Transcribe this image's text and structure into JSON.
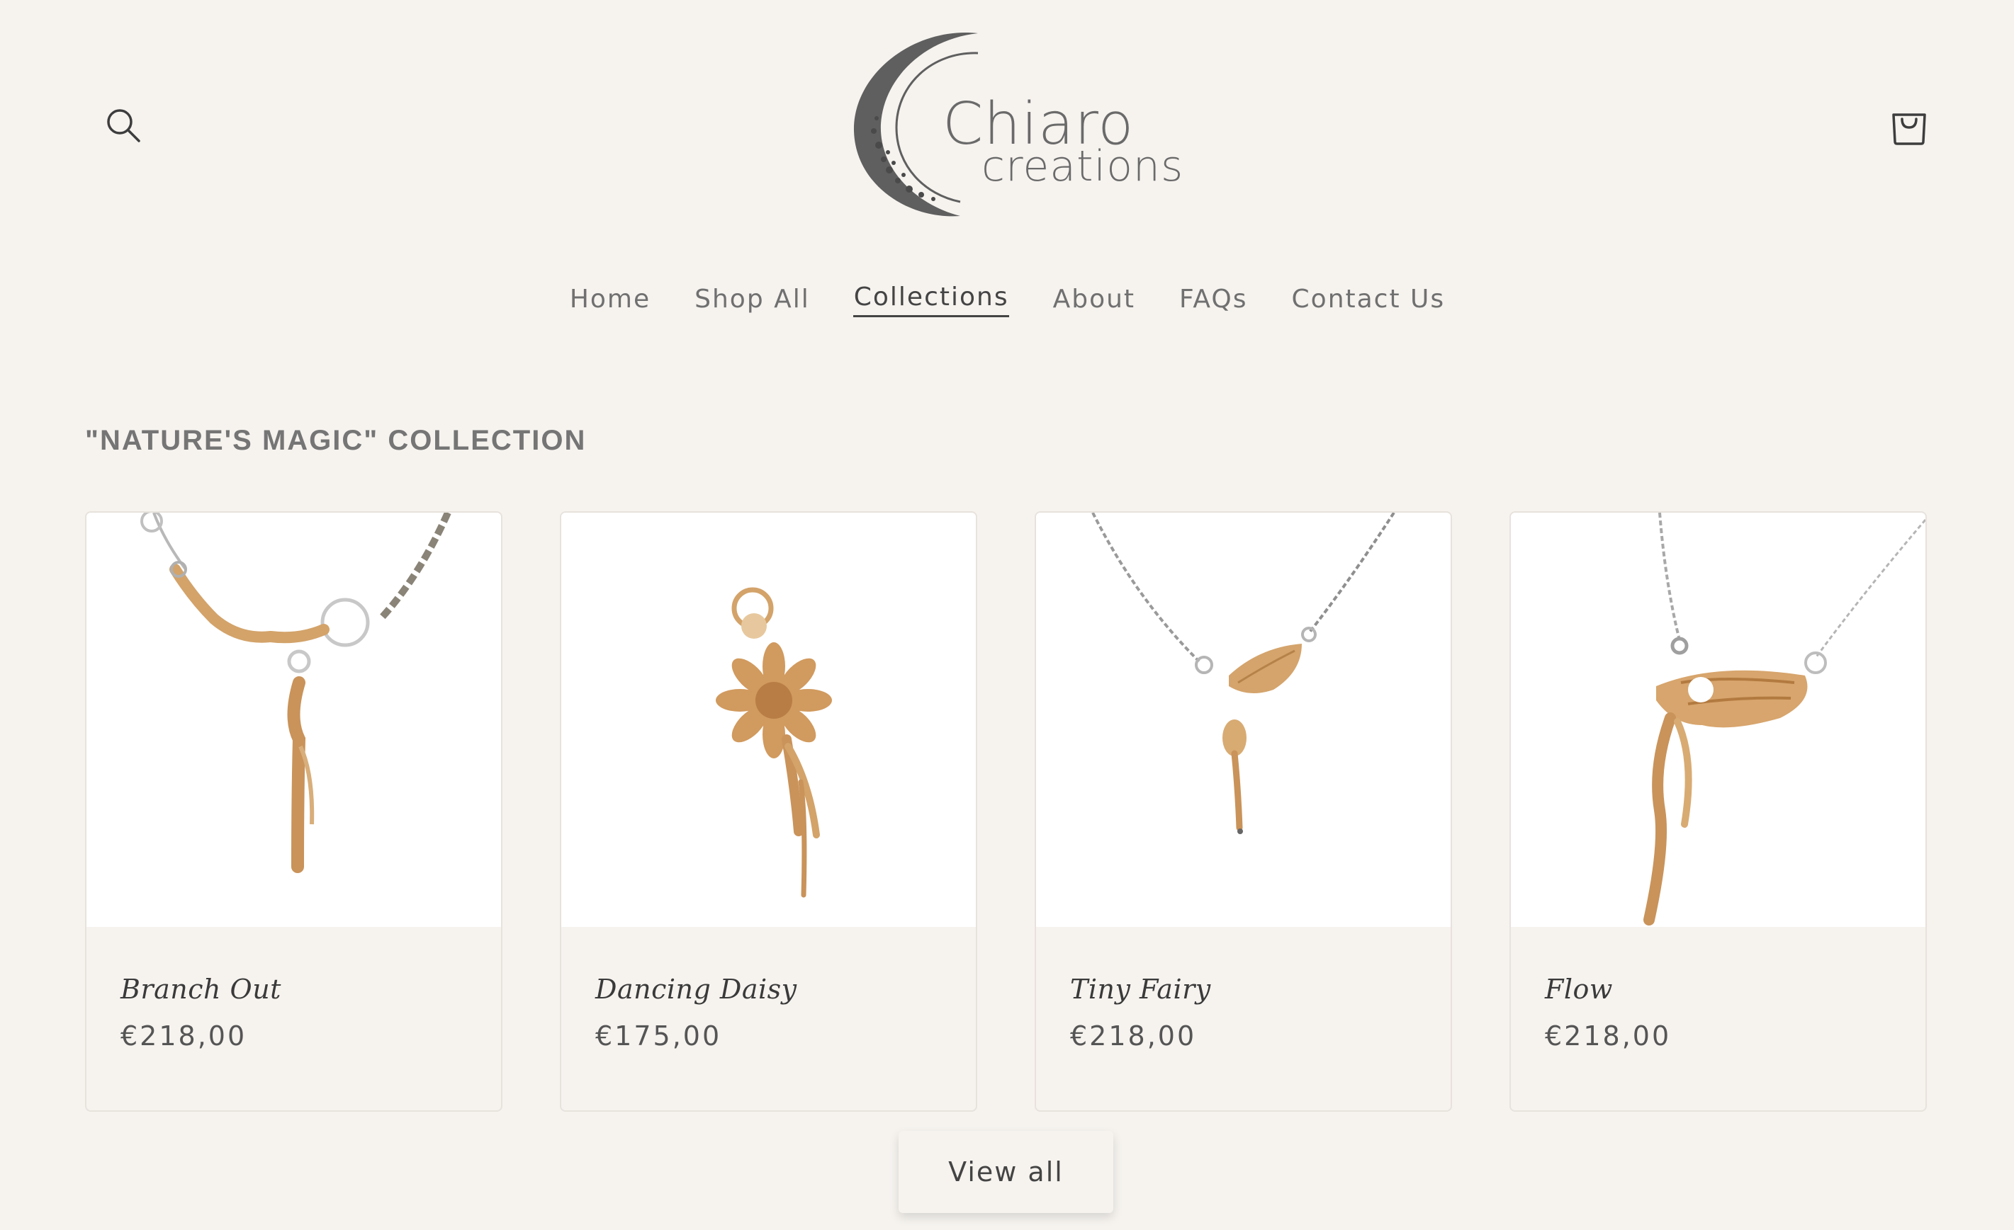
{
  "header": {
    "logo": {
      "name": "Chiaro",
      "tagline": "creations"
    },
    "search_icon": "search-icon",
    "cart_icon": "cart-icon"
  },
  "nav": {
    "items": [
      {
        "label": "Home",
        "active": false
      },
      {
        "label": "Shop All",
        "active": false
      },
      {
        "label": "Collections",
        "active": true
      },
      {
        "label": "About",
        "active": false
      },
      {
        "label": "FAQs",
        "active": false
      },
      {
        "label": "Contact Us",
        "active": false
      }
    ]
  },
  "collection": {
    "title": "\"NATURE'S MAGIC\" COLLECTION",
    "products": [
      {
        "name": "Branch Out",
        "price": "€218,00"
      },
      {
        "name": "Dancing Daisy",
        "price": "€175,00"
      },
      {
        "name": "Tiny Fairy",
        "price": "€218,00"
      },
      {
        "name": "Flow",
        "price": "€218,00"
      }
    ],
    "view_all_label": "View all"
  },
  "colors": {
    "background": "#f6f3ef",
    "text": "#3d3d3d",
    "gold": "#c9935a"
  }
}
